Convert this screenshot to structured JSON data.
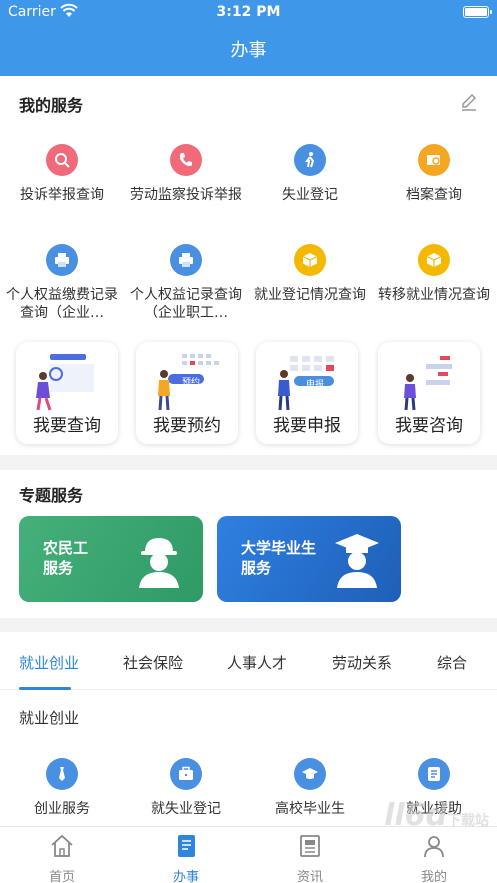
{
  "status": {
    "carrier": "Carrier",
    "time": "3:12 PM"
  },
  "nav": {
    "title": "办事"
  },
  "my_services": {
    "title": "我的服务",
    "items": [
      {
        "label": "投诉举报查询",
        "icon": "search-magnifier-icon",
        "color": "#f06a7a"
      },
      {
        "label": "劳动监察投诉举报",
        "icon": "phone-icon",
        "color": "#f06a7a"
      },
      {
        "label": "失业登记",
        "icon": "person-walking-icon",
        "color": "#4a90e2"
      },
      {
        "label": "档案查询",
        "icon": "folder-search-icon",
        "color": "#f5a623"
      },
      {
        "label": "个人权益缴费记录查询（企业…",
        "icon": "printer-icon",
        "color": "#4a90e2"
      },
      {
        "label": "个人权益记录查询（企业职工…",
        "icon": "printer-icon",
        "color": "#4a90e2"
      },
      {
        "label": "就业登记情况查询",
        "icon": "box-icon",
        "color": "#f5b800"
      },
      {
        "label": "转移就业情况查询",
        "icon": "box-icon",
        "color": "#f5b800"
      }
    ],
    "cards": [
      {
        "label": "我要查询"
      },
      {
        "label": "我要预约",
        "tag": "预约"
      },
      {
        "label": "我要申报",
        "tag": "申报"
      },
      {
        "label": "我要咨询"
      }
    ]
  },
  "topic": {
    "title": "专题服务",
    "banners": [
      {
        "line1": "农民工",
        "line2": "服务",
        "color": "#4caf7a"
      },
      {
        "line1": "大学毕业生",
        "line2": "服务",
        "color": "#2a6fd0"
      }
    ]
  },
  "tabs": {
    "items": [
      "就业创业",
      "社会保险",
      "人事人才",
      "劳动关系",
      "综合"
    ],
    "active": "就业创业",
    "subhead": "就业创业",
    "grid": [
      {
        "label": "创业服务",
        "icon": "tie-icon"
      },
      {
        "label": "就失业登记",
        "icon": "briefcase-icon"
      },
      {
        "label": "高校毕业生",
        "icon": "graduation-cap-icon"
      },
      {
        "label": "就业援助",
        "icon": "document-icon"
      }
    ]
  },
  "bottom_nav": [
    {
      "label": "首页",
      "icon": "home-icon"
    },
    {
      "label": "办事",
      "icon": "notebook-icon"
    },
    {
      "label": "资讯",
      "icon": "news-icon"
    },
    {
      "label": "我的",
      "icon": "user-icon"
    }
  ],
  "watermark": {
    "text": "ll6d",
    "suffix": "下载站"
  },
  "colors": {
    "primary": "#3e97e8",
    "active": "#2d86dc"
  }
}
